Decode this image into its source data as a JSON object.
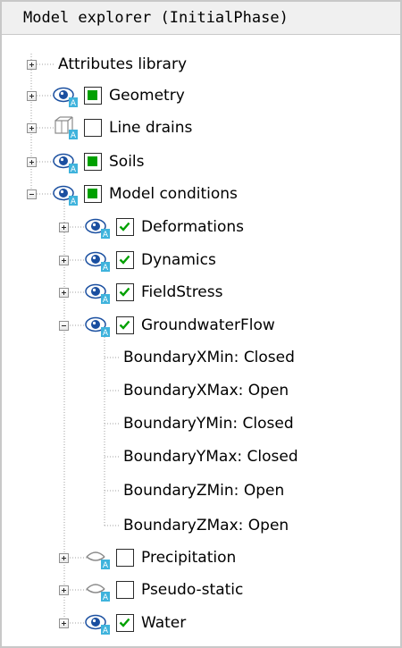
{
  "panel": {
    "title": "Model explorer (InitialPhase)"
  },
  "tree": {
    "attributes_library": "Attributes library",
    "geometry": "Geometry",
    "line_drains": "Line drains",
    "soils": "Soils",
    "model_conditions": "Model conditions",
    "deformations": "Deformations",
    "dynamics": "Dynamics",
    "field_stress": "FieldStress",
    "groundwater_flow": "GroundwaterFlow",
    "gw_params": [
      "BoundaryXMin: Closed",
      "BoundaryXMax: Open",
      "BoundaryYMin: Closed",
      "BoundaryYMax: Closed",
      "BoundaryZMin: Open",
      "BoundaryZMax: Open"
    ],
    "precipitation": "Precipitation",
    "pseudo_static": "Pseudo-static",
    "water": "Water"
  },
  "colors": {
    "check_green": "#00a000",
    "eye_blue": "#1a4fa0",
    "accent_cyan": "#3fb3dc"
  }
}
